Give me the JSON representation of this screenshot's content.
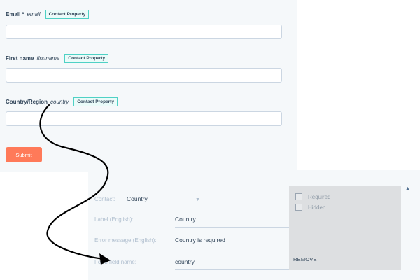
{
  "form": {
    "fields": [
      {
        "label": "Email",
        "required_mark": "*",
        "internal_name": "email",
        "badge": "Contact Property"
      },
      {
        "label": "First name",
        "internal_name": "firstname",
        "badge": "Contact Property"
      },
      {
        "label": "Country/Region",
        "internal_name": "country",
        "badge": "Contact Property"
      }
    ],
    "submit_label": "Submit"
  },
  "editor": {
    "contact_label": "Contact:",
    "contact_value": "Country",
    "label_label": "Label (English):",
    "label_value": "Country",
    "error_label": "Error message (English):",
    "error_value": "Country is required",
    "field_name_label": "Form field name:",
    "field_name_value": "country"
  },
  "options": {
    "required_label": "Required",
    "hidden_label": "Hidden",
    "remove_label": "REMOVE"
  },
  "colors": {
    "accent_orange": "#ff7a59",
    "badge_teal": "#4fd1c5",
    "panel_bg": "#f5f8fa",
    "options_bg": "#dddfe1"
  },
  "icons": [
    "chevron-down-icon",
    "chevron-up-icon",
    "curved-arrow-icon"
  ]
}
